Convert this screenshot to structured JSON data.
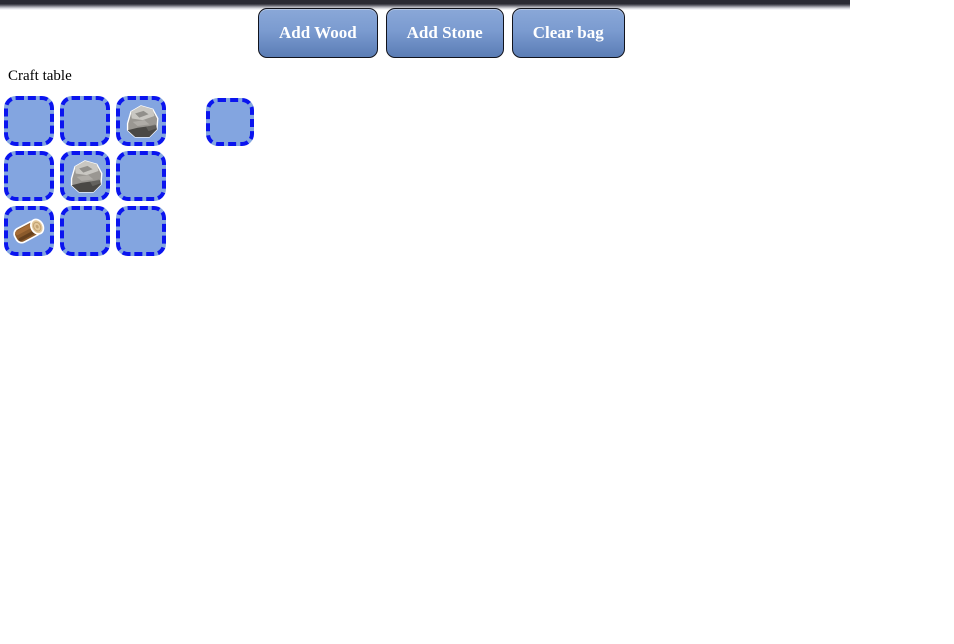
{
  "toolbar": {
    "buttons": [
      {
        "label": "Add Wood",
        "name": "add-wood-button"
      },
      {
        "label": "Add Stone",
        "name": "add-stone-button"
      },
      {
        "label": "Clear bag",
        "name": "clear-bag-button"
      }
    ]
  },
  "craft": {
    "label": "Craft table",
    "grid": {
      "rows": 3,
      "cols": 3,
      "cells": [
        {
          "index": 0,
          "item": ""
        },
        {
          "index": 1,
          "item": ""
        },
        {
          "index": 2,
          "item": "stone"
        },
        {
          "index": 3,
          "item": ""
        },
        {
          "index": 4,
          "item": "stone"
        },
        {
          "index": 5,
          "item": ""
        },
        {
          "index": 6,
          "item": "wood"
        },
        {
          "index": 7,
          "item": ""
        },
        {
          "index": 8,
          "item": ""
        }
      ]
    },
    "output": {
      "item": ""
    }
  },
  "colors": {
    "slot_fill": "#83a5e0",
    "slot_border": "#0a14ef",
    "button_top": "#8aa8d8",
    "button_bottom": "#5b7db5",
    "button_border": "#11131c",
    "button_text": "#ffffff",
    "top_strip": "#2b2b33",
    "page_background": "#ffffff",
    "label_text": "#000000",
    "stone_light": "#c9c7c2",
    "stone_mid": "#9a9792",
    "stone_dark": "#4a4845",
    "wood_bark": "#8b5a2b",
    "wood_dark": "#5e3b1c",
    "wood_end": "#e3c89c"
  }
}
